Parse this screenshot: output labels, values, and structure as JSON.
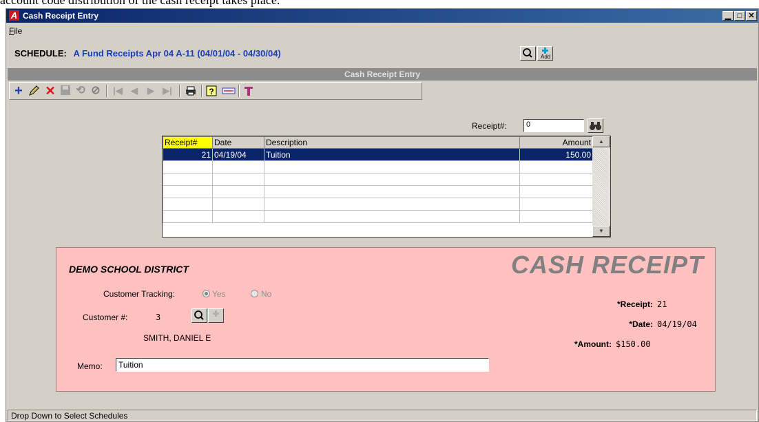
{
  "top_text": "account code distribution of the cash receipt takes place.",
  "window": {
    "title": "Cash Receipt Entry",
    "controls": [
      "_",
      "□",
      "X"
    ]
  },
  "menu": {
    "file_label": "File"
  },
  "schedule": {
    "label": "SCHEDULE:",
    "value": "A Fund Receipts Apr 04   A-11   (04/01/04 - 04/30/04)",
    "add_label": "Add"
  },
  "panel": {
    "header": "Cash Receipt Entry"
  },
  "toolbar": {
    "icons": [
      "add-icon",
      "edit-icon",
      "delete-icon",
      "save-icon",
      "undo-icon",
      "cancel-icon",
      "first-record-icon",
      "previous-record-icon",
      "next-record-icon",
      "last-record-icon",
      "print-icon",
      "help-icon",
      "check-icon",
      "filter-icon"
    ]
  },
  "search": {
    "label": "Receipt#:",
    "value": "0"
  },
  "grid": {
    "columns": [
      "Receipt#",
      "Date",
      "Description",
      "Amount"
    ],
    "rows": [
      {
        "receipt": "21",
        "date": "04/19/04",
        "description": "Tuition",
        "amount": "150.00"
      }
    ]
  },
  "receipt": {
    "org_name": "DEMO SCHOOL DISTRICT",
    "title": "CASH RECEIPT",
    "tracking_label": "Customer Tracking:",
    "tracking_yes": "Yes",
    "tracking_no": "No",
    "customer_label": "Customer #:",
    "customer_value": "3",
    "customer_name": "SMITH, DANIEL E",
    "memo_label": "Memo:",
    "memo_value": "Tuition",
    "receipt_label": "*Receipt:",
    "receipt_value": "21",
    "date_label": "*Date:",
    "date_value": "04/19/04",
    "amount_label": "*Amount:",
    "amount_value": "$150.00"
  },
  "status": {
    "text": "Drop Down to Select Schedules"
  }
}
